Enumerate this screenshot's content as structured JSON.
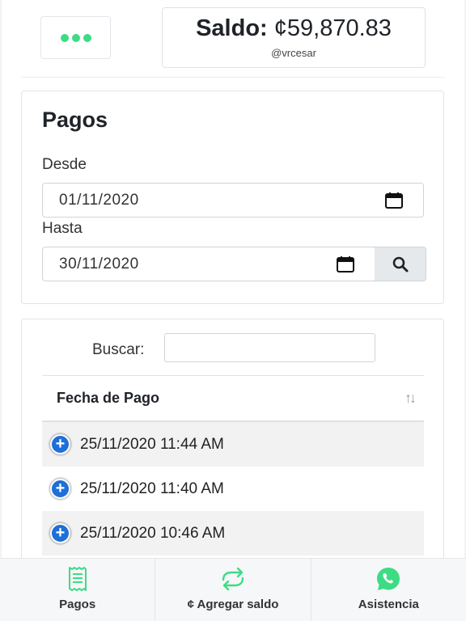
{
  "header": {
    "menu_icon": "ellipsis-icon",
    "balance_label": "Saldo:",
    "balance_value": "¢59,870.83",
    "username": "@vrcesar"
  },
  "filters": {
    "title": "Pagos",
    "from_label": "Desde",
    "from_value": "01/11/2020",
    "to_label": "Hasta",
    "to_value": "30/11/2020",
    "calendar_icon": "calendar-icon",
    "search_icon": "search-icon"
  },
  "table": {
    "search_label": "Buscar:",
    "search_value": "",
    "column_header": "Fecha de Pago",
    "sort_icon": "↑↓",
    "rows": [
      {
        "date": "25/11/2020 11:44 AM"
      },
      {
        "date": "25/11/2020 11:40 AM"
      },
      {
        "date": "25/11/2020 10:46 AM"
      }
    ]
  },
  "bottom_nav": {
    "items": [
      {
        "label": "Pagos",
        "icon": "receipt-icon"
      },
      {
        "label": "¢ Agregar saldo",
        "icon": "transfer-icon"
      },
      {
        "label": "Asistencia",
        "icon": "whatsapp-icon"
      }
    ]
  },
  "colors": {
    "accent_green": "#3ddc84",
    "expand_blue": "#1e6fd9"
  }
}
